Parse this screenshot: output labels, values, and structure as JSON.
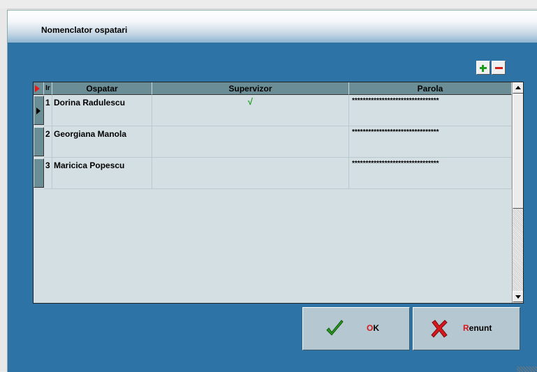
{
  "window": {
    "title": "Nomenclator ospatari"
  },
  "toolbar": {
    "add_icon": "plus-icon",
    "remove_icon": "minus-icon"
  },
  "grid": {
    "columns": {
      "index": "Ir",
      "ospatar": "Ospatar",
      "supervizor": "Supervizor",
      "parola": "Parola"
    },
    "rows": [
      {
        "index": "1",
        "ospatar": "Dorina Radulescu",
        "supervizor": "√",
        "parola": "********************************"
      },
      {
        "index": "2",
        "ospatar": "Georgiana Manola",
        "supervizor": "",
        "parola": "********************************"
      },
      {
        "index": "3",
        "ospatar": "Maricica Popescu",
        "supervizor": "",
        "parola": "********************************"
      }
    ]
  },
  "buttons": {
    "ok": {
      "accel": "O",
      "rest": "K",
      "icon": "checkmark-icon"
    },
    "cancel": {
      "accel": "R",
      "rest": "enunt",
      "icon": "x-icon"
    }
  },
  "colors": {
    "dialog_bg": "#2d73a6",
    "grid_header": "#6b8e96",
    "grid_bg": "#d3dfe3",
    "accent_red": "#d6171c",
    "accent_green": "#1e9a1e"
  }
}
